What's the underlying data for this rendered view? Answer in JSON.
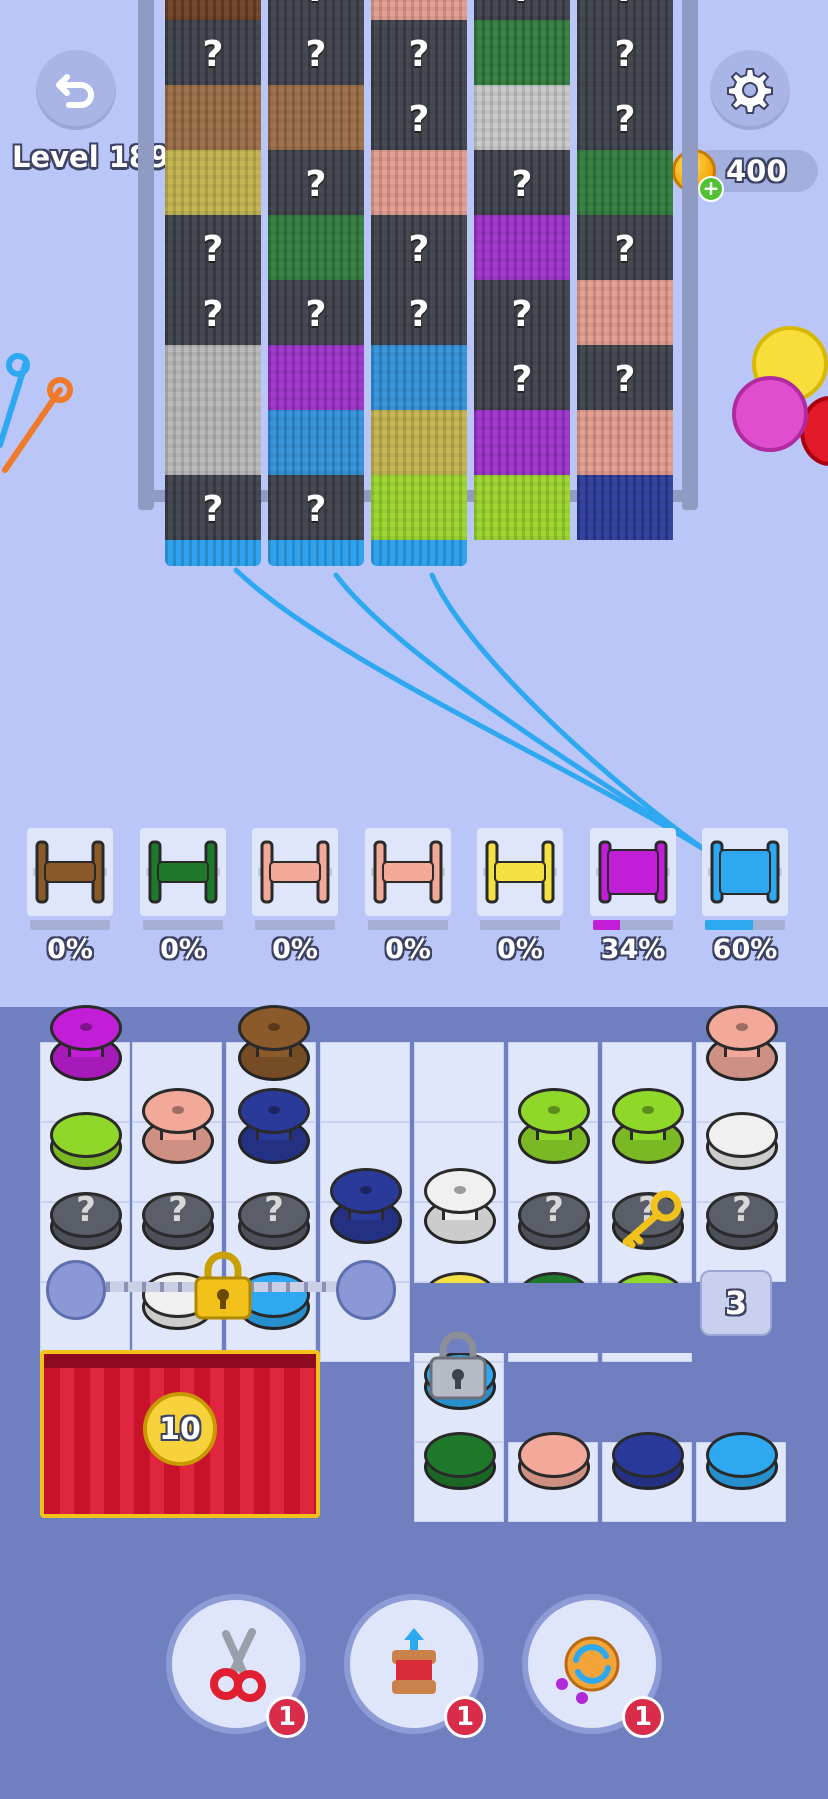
{
  "level_label": "Level 189",
  "coins": "400",
  "icons": {
    "undo": "undo-icon",
    "settings": "gear-icon",
    "coin": "coin-icon",
    "plus": "plus-icon",
    "lock": "padlock-icon",
    "key": "key-icon",
    "scissors": "scissors-icon",
    "spool_up": "spool-arrow-icon",
    "yarn_swap": "yarn-swap-icon"
  },
  "mystery_mark": "?",
  "fabric_columns": [
    [
      "#6b3e22",
      "mystery",
      "#9a6b43",
      "#c2b24c",
      "mystery",
      "mystery",
      "#b7b7b7",
      "#b7b7b7",
      "mystery"
    ],
    [
      "mystery",
      "mystery",
      "#9a6b43",
      "mystery",
      "#2f7a3a",
      "mystery",
      "#9a2fc9",
      "#2f8fd8",
      "mystery"
    ],
    [
      "#e29a8c",
      "mystery",
      "mystery",
      "#e29a8c",
      "mystery",
      "mystery",
      "#2f8fd8",
      "#c2b24c",
      "#9ad52a"
    ],
    [
      "mystery",
      "#2f7a3a",
      "#c7c7c7",
      "mystery",
      "#9a2fc9",
      "mystery",
      "mystery",
      "#9a2fc9",
      "#9ad52a"
    ],
    [
      "mystery",
      "mystery",
      "mystery",
      "#2f7a3a",
      "mystery",
      "#e29a8c",
      "mystery",
      "#e29a8c",
      "#2a3a9a"
    ]
  ],
  "spool_slots": [
    {
      "color": "#8b5a2b",
      "percent": "0%",
      "progress": 0
    },
    {
      "color": "#1e7a2a",
      "percent": "0%",
      "progress": 0
    },
    {
      "color": "#f2a99a",
      "percent": "0%",
      "progress": 0
    },
    {
      "color": "#f2a99a",
      "percent": "0%",
      "progress": 0
    },
    {
      "color": "#f5e042",
      "percent": "0%",
      "progress": 0
    },
    {
      "color": "#c21ed8",
      "percent": "34%",
      "progress": 0.34
    },
    {
      "color": "#2ea8f0",
      "percent": "60%",
      "progress": 0.6
    }
  ],
  "locked_chain_count": "",
  "curtain_count": "10",
  "hidden_stack_count": "3",
  "powerups": [
    {
      "name": "scissors",
      "count": "1"
    },
    {
      "name": "spool-boost",
      "count": "1"
    },
    {
      "name": "yarn-swap",
      "count": "1"
    }
  ],
  "colors": {
    "background": "#b9c6f7",
    "board": "#6f7fbf",
    "accent_red": "#d92b4a"
  }
}
